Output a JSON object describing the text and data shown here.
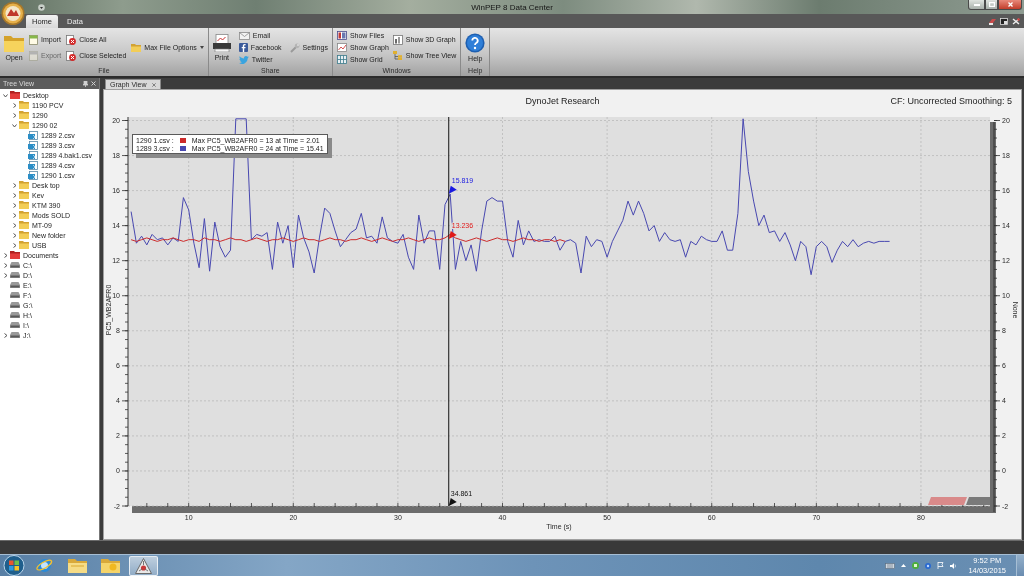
{
  "window": {
    "title": "WinPEP 8 Data Center"
  },
  "ribbon": {
    "tabs": [
      {
        "label": "Home",
        "selected": true
      },
      {
        "label": "Data",
        "selected": false
      }
    ],
    "groups": [
      {
        "label": "File",
        "columns": [
          {
            "buttons": [
              {
                "label": "Open",
                "kind": "large",
                "disabled": false
              }
            ]
          },
          {
            "buttons": [
              {
                "label": "Import",
                "kind": "small",
                "disabled": false
              },
              {
                "label": "Export",
                "kind": "small",
                "disabled": true
              }
            ]
          },
          {
            "buttons": [
              {
                "label": "Close All",
                "kind": "small",
                "disabled": false
              },
              {
                "label": "Close Selected",
                "kind": "small",
                "disabled": false
              }
            ]
          },
          {
            "buttons": [
              {
                "label": "Max File Options",
                "kind": "menu",
                "disabled": false
              }
            ]
          }
        ]
      },
      {
        "label": "Share",
        "columns": [
          {
            "buttons": [
              {
                "label": "Print",
                "kind": "large",
                "disabled": false
              }
            ]
          },
          {
            "buttons": [
              {
                "label": "Email",
                "kind": "small",
                "disabled": false
              },
              {
                "label": "Facebook",
                "kind": "small",
                "disabled": false
              },
              {
                "label": "Twitter",
                "kind": "small",
                "disabled": false
              }
            ]
          },
          {
            "buttons": [
              {
                "label": "Settings",
                "kind": "small",
                "disabled": false
              }
            ]
          }
        ]
      },
      {
        "label": "Windows",
        "columns": [
          {
            "buttons": [
              {
                "label": "Show Files",
                "kind": "small",
                "disabled": false
              },
              {
                "label": "Show Graph",
                "kind": "small",
                "disabled": false
              },
              {
                "label": "Show Grid",
                "kind": "small",
                "disabled": false
              }
            ]
          },
          {
            "buttons": [
              {
                "label": "Show 3D Graph",
                "kind": "small",
                "disabled": false
              },
              {
                "label": "Show Tree View",
                "kind": "small",
                "disabled": false
              }
            ]
          }
        ]
      },
      {
        "label": "Help",
        "columns": [
          {
            "buttons": [
              {
                "label": "Help",
                "kind": "large",
                "disabled": false
              }
            ]
          }
        ]
      }
    ]
  },
  "tree_view": {
    "title": "Tree View",
    "items": [
      {
        "label": "Desktop",
        "kind": "special",
        "expandable": true,
        "expanded": true,
        "children": [
          {
            "label": "1190 PCV",
            "kind": "folder",
            "expandable": true,
            "expanded": false
          },
          {
            "label": "1290",
            "kind": "folder",
            "expandable": true,
            "expanded": false
          },
          {
            "label": "1290 02",
            "kind": "folder",
            "expandable": true,
            "expanded": true,
            "children": [
              {
                "label": "1289 2.csv",
                "kind": "file",
                "expandable": false,
                "expanded": false
              },
              {
                "label": "1289 3.csv",
                "kind": "file",
                "expandable": false,
                "expanded": false
              },
              {
                "label": "1289 4.bak1.csv",
                "kind": "file",
                "expandable": false,
                "expanded": false
              },
              {
                "label": "1289 4.csv",
                "kind": "file",
                "expandable": false,
                "expanded": false
              },
              {
                "label": "1290 1.csv",
                "kind": "file",
                "expandable": false,
                "expanded": false
              }
            ]
          },
          {
            "label": "Desk top",
            "kind": "folder",
            "expandable": true,
            "expanded": false
          },
          {
            "label": "Kev",
            "kind": "folder",
            "expandable": true,
            "expanded": false
          },
          {
            "label": "KTM 390",
            "kind": "folder",
            "expandable": true,
            "expanded": false
          },
          {
            "label": "Mods SOLD",
            "kind": "folder",
            "expandable": true,
            "expanded": false
          },
          {
            "label": "MT-09",
            "kind": "folder",
            "expandable": true,
            "expanded": false
          },
          {
            "label": "New folder",
            "kind": "folder",
            "expandable": true,
            "expanded": false
          },
          {
            "label": "USB",
            "kind": "folder",
            "expandable": true,
            "expanded": false
          }
        ]
      },
      {
        "label": "Documents",
        "kind": "special",
        "expandable": true,
        "expanded": false
      },
      {
        "label": "C:\\",
        "kind": "drive",
        "expandable": true,
        "expanded": false
      },
      {
        "label": "D:\\",
        "kind": "drive",
        "expandable": true,
        "expanded": false
      },
      {
        "label": "E:\\",
        "kind": "drive",
        "expandable": false,
        "expanded": false
      },
      {
        "label": "F:\\",
        "kind": "drive",
        "expandable": false,
        "expanded": false
      },
      {
        "label": "G:\\",
        "kind": "drive",
        "expandable": false,
        "expanded": false
      },
      {
        "label": "H:\\",
        "kind": "drive",
        "expandable": false,
        "expanded": false
      },
      {
        "label": "I:\\",
        "kind": "drive",
        "expandable": false,
        "expanded": false
      },
      {
        "label": "J:\\",
        "kind": "drive",
        "expandable": true,
        "expanded": false
      }
    ]
  },
  "graph_view": {
    "tab": {
      "label": "Graph View",
      "selected": true
    },
    "status": "CF: Uncorrected Smoothing: 5",
    "legend": [
      {
        "text": "Max PC5_WB2AFR0 = 13 at Time = 2.01"
      },
      {
        "text": "Max PC5_WB2AFR0 = 24 at Time = 15.41"
      }
    ],
    "right_axis": {
      "label": "None",
      "ticks": [
        "20",
        "18",
        "16",
        "14",
        "12",
        "10",
        "8",
        "6",
        "4",
        "2",
        "0",
        "-2"
      ]
    },
    "chart_data": {
      "type": "line",
      "title": "DynoJet Research",
      "xlabel": "Time (s)",
      "ylabel": "PC5_WB2AFR0",
      "grid": true,
      "x": [
        4.5,
        5,
        5.5,
        6,
        6.5,
        7,
        7.5,
        8,
        8.5,
        9,
        9.5,
        10,
        10.5,
        11,
        11.5,
        12,
        12.5,
        13,
        13.5,
        14,
        14.5,
        15,
        15.5,
        16,
        16.5,
        17,
        17.5,
        18,
        18.5,
        19,
        19.5,
        20,
        20.5,
        21,
        21.5,
        22,
        22.5,
        23,
        23.5,
        24,
        24.5,
        25,
        25.5,
        26,
        26.5,
        27,
        27.5,
        28,
        28.5,
        29,
        29.5,
        30,
        30.5,
        31,
        31.5,
        32,
        32.5,
        33,
        33.5,
        34,
        34.5,
        35,
        35.5,
        36,
        36.5,
        37,
        37.5,
        38,
        38.5,
        39,
        39.5,
        40,
        40.5,
        41,
        41.5,
        42,
        42.5,
        43,
        43.5,
        44,
        44.5,
        45,
        45.5,
        46,
        46.5,
        47,
        47.5,
        48,
        48.5,
        49,
        49.5,
        50,
        50.5,
        51,
        51.5,
        52,
        52.5,
        53,
        53.5,
        54,
        54.5,
        55,
        55.5,
        56,
        56.5,
        57,
        57.5,
        58,
        58.5,
        59,
        59.5,
        60,
        60.5,
        61,
        61.5,
        62,
        62.5,
        63,
        63.5,
        64,
        64.5,
        65,
        65.5,
        66,
        66.5,
        67,
        67.5,
        68,
        68.5,
        69,
        69.5,
        70,
        70.5,
        71,
        71.5,
        72,
        72.5,
        73,
        73.5,
        74,
        74.5,
        75,
        75.5,
        76,
        76.5,
        77
      ],
      "series": [
        {
          "name": "1290 1.csv :",
          "color": "#cc2a2a",
          "values": [
            13.2,
            13.1,
            13.2,
            13.3,
            13.2,
            13.1,
            13.2,
            13.2,
            13.3,
            13.2,
            13.1,
            13.2,
            13.2,
            13.1,
            13.3,
            13.2,
            13.2,
            13.1,
            13.2,
            13.3,
            13.2,
            13.2,
            13.1,
            13.2,
            13.3,
            13.2,
            13.1,
            13.2,
            13.2,
            13.3,
            13.2,
            13.1,
            13.2,
            13.3,
            13.2,
            13.2,
            13.1,
            13.2,
            13.3,
            13.2,
            13.2,
            13.1,
            13.2,
            13.2,
            13.3,
            13.2,
            13.1,
            13.2,
            13.3,
            13.2,
            13.1,
            13.2,
            13.2,
            13.3,
            13.2,
            13.1,
            13.2,
            13.3,
            13.2,
            13.2,
            13.3,
            13.5,
            13.3,
            13.2,
            13.1,
            13.2,
            13.3,
            13.2,
            13.1,
            13.2,
            13.3,
            13.2,
            13.2,
            13.1,
            13.2,
            13.3,
            13.2,
            13.2,
            13.1,
            13.2,
            13.2,
            13.1,
            13.2,
            13.1,
            null,
            null,
            null,
            null,
            null,
            null,
            null,
            null,
            null,
            null,
            null,
            null,
            null,
            null,
            null,
            null,
            null,
            null,
            null,
            null,
            null,
            null,
            null,
            null,
            null,
            null,
            null,
            null,
            null,
            null,
            null,
            null,
            null,
            null,
            null,
            null,
            null,
            null,
            null,
            null,
            null,
            null,
            null,
            null,
            null,
            null,
            null,
            null,
            null,
            null,
            null,
            null,
            null,
            null,
            null,
            null,
            null,
            null,
            null,
            null,
            null,
            null
          ]
        },
        {
          "name": "1289 3.csv :",
          "color": "#4848b0",
          "values": [
            14.8,
            13.0,
            13.4,
            12.9,
            13.5,
            13.2,
            13.3,
            12.9,
            13.3,
            13.1,
            15.6,
            14.9,
            13.0,
            11.6,
            14.4,
            11.4,
            14.2,
            12.8,
            12.2,
            12.6,
            20.1,
            20.1,
            20.1,
            13.2,
            13.5,
            13.4,
            13.6,
            11.5,
            14.2,
            13.0,
            14.0,
            11.6,
            14.6,
            13.3,
            12.5,
            11.3,
            13.3,
            15.0,
            14.7,
            13.7,
            12.8,
            13.2,
            13.6,
            13.8,
            14.7,
            13.3,
            13.4,
            13.0,
            14.5,
            13.3,
            13.1,
            13.0,
            13.5,
            12.2,
            11.5,
            14.6,
            13.0,
            13.7,
            13.7,
            11.5,
            15.2,
            15.8,
            11.5,
            13.1,
            12.0,
            12.9,
            11.4,
            13.7,
            15.4,
            15.6,
            15.4,
            15.4,
            13.1,
            12.2,
            14.3,
            12.9,
            13.7,
            13.1,
            13.2,
            13.1,
            13.1,
            13.4,
            12.6,
            13.1,
            13.2,
            13.0,
            11.3,
            13.4,
            12.8,
            13.2,
            13.1,
            12.2,
            13.1,
            13.7,
            14.3,
            15.4,
            14.6,
            15.4,
            14.7,
            13.7,
            14.0,
            13.1,
            13.6,
            13.2,
            13.1,
            13.2,
            12.2,
            13.1,
            12.9,
            13.4,
            13.2,
            13.1,
            13.1,
            13.7,
            12.6,
            12.6,
            14.7,
            20.1,
            17.1,
            15.4,
            14.0,
            14.6,
            13.6,
            13.7,
            13.1,
            13.6,
            12.9,
            12.0,
            13.1,
            12.8,
            11.2,
            12.8,
            13.1,
            12.8,
            11.9,
            12.6,
            13.1,
            12.8,
            13.2,
            12.8,
            13.0,
            13.1,
            13.0,
            13.1,
            13.1,
            13.1
          ]
        }
      ],
      "xlim": [
        4.2,
        86.6
      ],
      "ylim": [
        -2,
        20.2
      ],
      "xticks": [
        10,
        20,
        30,
        40,
        50,
        60,
        70,
        80
      ],
      "yticks": [
        -2,
        0,
        2,
        4,
        6,
        8,
        10,
        12,
        14,
        16,
        18,
        20
      ],
      "ref_lines": [
        {
          "axis": "x",
          "value": 34.861,
          "label": "34.861"
        }
      ],
      "annotations": [
        {
          "x": 34.861,
          "y": 15.819,
          "text": "15.819"
        },
        {
          "x": 34.861,
          "y": 13.236,
          "text": "13.236"
        }
      ]
    }
  },
  "taskbar": {
    "apps": [
      {
        "selected": false
      },
      {
        "selected": false
      },
      {
        "selected": false
      },
      {
        "selected": true
      }
    ],
    "clock": {
      "time": "9:52 PM",
      "date": "14/03/2015"
    }
  }
}
